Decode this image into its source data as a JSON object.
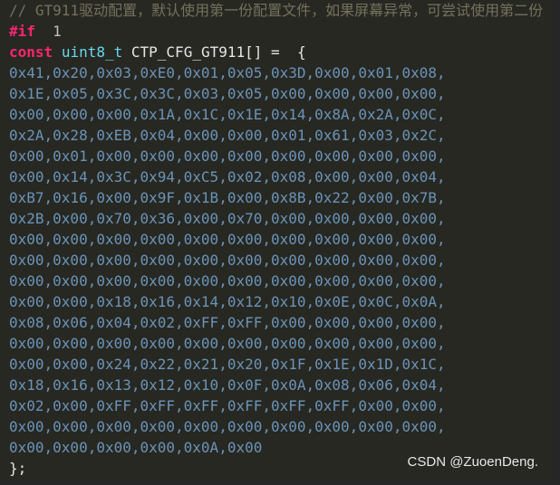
{
  "code": {
    "comment_line": "// GT911驱动配置，默认使用第一份配置文件，如果屏幕异常，可尝试使用第二份",
    "directive_keyword": "#if",
    "directive_value": "1",
    "decl_keyword": "const",
    "decl_type": "uint8_t",
    "decl_name": "CTP_CFG_GT911[]",
    "decl_equals": "=",
    "decl_brace": "{",
    "hex_rows": [
      "0x41,0x20,0x03,0xE0,0x01,0x05,0x3D,0x00,0x01,0x08,",
      "0x1E,0x05,0x3C,0x3C,0x03,0x05,0x00,0x00,0x00,0x00,",
      "0x00,0x00,0x00,0x1A,0x1C,0x1E,0x14,0x8A,0x2A,0x0C,",
      "0x2A,0x28,0xEB,0x04,0x00,0x00,0x01,0x61,0x03,0x2C,",
      "0x00,0x01,0x00,0x00,0x00,0x00,0x00,0x00,0x00,0x00,",
      "0x00,0x14,0x3C,0x94,0xC5,0x02,0x08,0x00,0x00,0x04,",
      "0xB7,0x16,0x00,0x9F,0x1B,0x00,0x8B,0x22,0x00,0x7B,",
      "0x2B,0x00,0x70,0x36,0x00,0x70,0x00,0x00,0x00,0x00,",
      "0x00,0x00,0x00,0x00,0x00,0x00,0x00,0x00,0x00,0x00,",
      "0x00,0x00,0x00,0x00,0x00,0x00,0x00,0x00,0x00,0x00,",
      "0x00,0x00,0x00,0x00,0x00,0x00,0x00,0x00,0x00,0x00,",
      "0x00,0x00,0x18,0x16,0x14,0x12,0x10,0x0E,0x0C,0x0A,",
      "0x08,0x06,0x04,0x02,0xFF,0xFF,0x00,0x00,0x00,0x00,",
      "0x00,0x00,0x00,0x00,0x00,0x00,0x00,0x00,0x00,0x00,",
      "0x00,0x00,0x24,0x22,0x21,0x20,0x1F,0x1E,0x1D,0x1C,",
      "0x18,0x16,0x13,0x12,0x10,0x0F,0x0A,0x08,0x06,0x04,",
      "0x02,0x00,0xFF,0xFF,0xFF,0xFF,0xFF,0xFF,0x00,0x00,",
      "0x00,0x00,0x00,0x00,0x00,0x00,0x00,0x00,0x00,0x00,",
      "0x00,0x00,0x00,0x00,0x0A,0x00"
    ],
    "closing": "};"
  },
  "watermark": "CSDN @ZuoenDeng.",
  "colors": {
    "background": "#272822",
    "comment": "#75715e",
    "keyword": "#f92672",
    "type": "#66d9ef",
    "hex": "#6b93b8"
  }
}
